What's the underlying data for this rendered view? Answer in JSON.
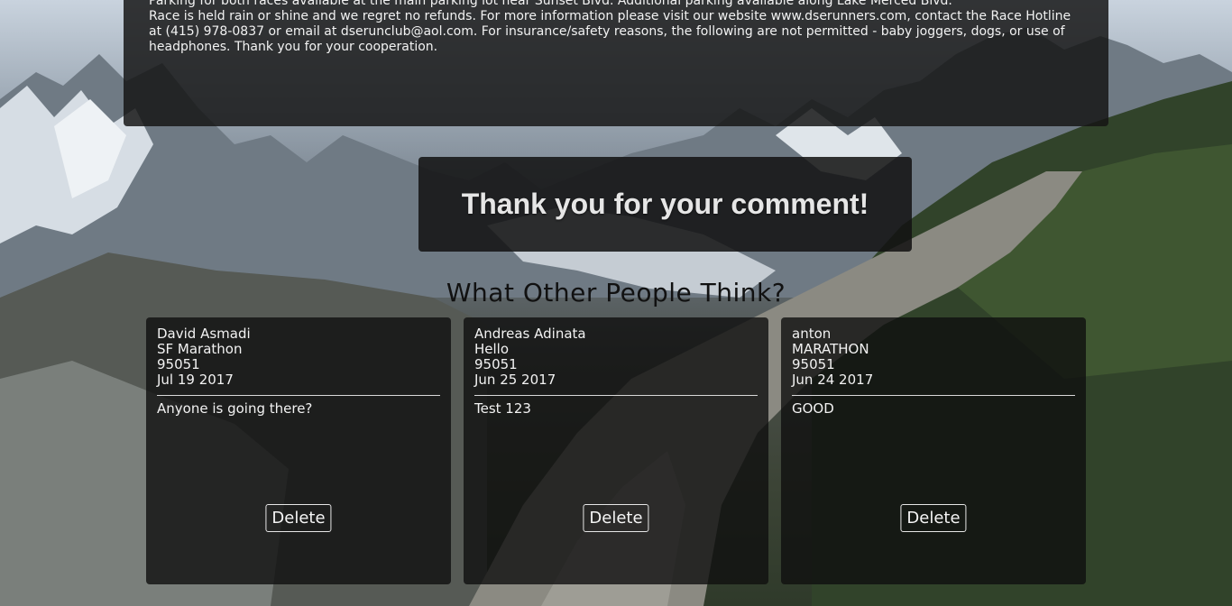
{
  "info": {
    "line1": "Parking for both races available at the main parking lot near Sunset Blvd.  Additional parking available along Lake Merced Blvd.",
    "line2": "Race is held rain or shine and we regret no refunds.  For more information please visit our website www.dserunners.com, contact the Race Hotline at (415) 978-0837 or email at dserunclub@aol.com.  For insurance/safety reasons, the following are not permitted - baby joggers, dogs, or use of headphones.  Thank you for your cooperation."
  },
  "thanks": {
    "message": "Thank you for your comment!"
  },
  "comments_section": {
    "title": "What Other People Think?",
    "delete_label": "Delete",
    "cards": [
      {
        "name": "David Asmadi",
        "race": "SF Marathon",
        "zip": "95051",
        "date": "Jul 19 2017",
        "comment": "Anyone is going there?"
      },
      {
        "name": "Andreas Adinata",
        "race": "Hello",
        "zip": "95051",
        "date": "Jun 25 2017",
        "comment": "Test 123"
      },
      {
        "name": "anton",
        "race": "MARATHON",
        "zip": "95051",
        "date": "Jun 24 2017",
        "comment": "GOOD"
      }
    ]
  },
  "colors": {
    "panel_bg": "#141414",
    "text": "#f2f2f2",
    "title_text": "#111111"
  }
}
